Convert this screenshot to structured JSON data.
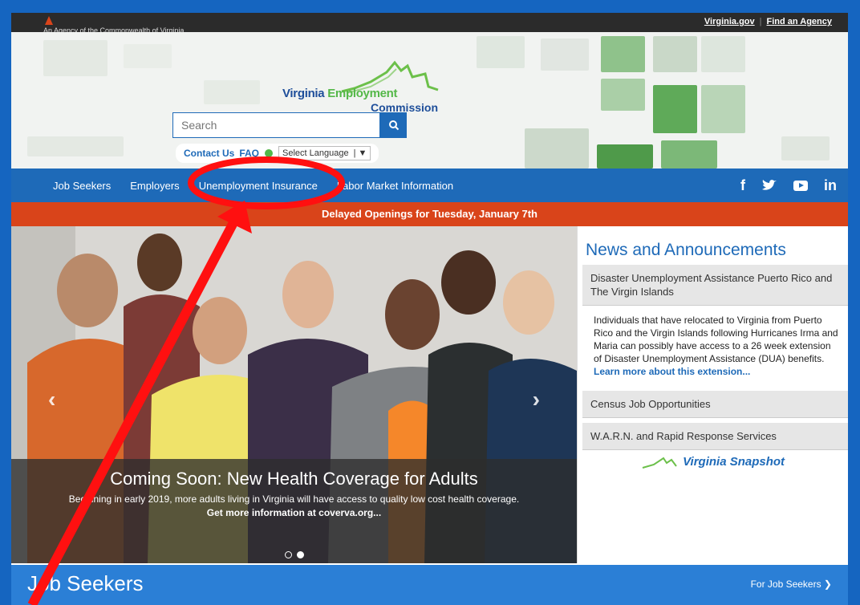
{
  "topbar": {
    "agency_text": "An Agency of the Commonwealth of Virginia",
    "links": [
      "Virginia.gov",
      "Find an Agency"
    ]
  },
  "logo": {
    "line1_a": "Virginia",
    "line1_b": "Employment",
    "line2": "Commission"
  },
  "search": {
    "placeholder": "Search"
  },
  "contacts": {
    "contact_us": "Contact Us",
    "faq": "FAQ",
    "language": "Select Language"
  },
  "nav": {
    "items": [
      "Job Seekers",
      "Employers",
      "Unemployment Insurance",
      "Labor Market Information"
    ]
  },
  "social": {
    "facebook": "f",
    "linkedin": "in"
  },
  "alert": {
    "text": "Delayed Openings for Tuesday, January 7th"
  },
  "carousel": {
    "heading": "Coming Soon: New Health Coverage for Adults",
    "body": "Beginning in early 2019, more adults living in Virginia will have access to quality low cost health coverage.",
    "link": "Get more information at coverva.org...",
    "prev": "‹",
    "next": "›"
  },
  "news": {
    "title": "News and Announcements",
    "items": [
      {
        "heading": "Disaster Unemployment Assistance Puerto Rico and The Virgin Islands",
        "body": "Individuals that have relocated to Virginia from Puerto Rico and the Virgin Islands following Hurricanes Irma and Maria can possibly have access to a 26 week extension of Disaster Unemployment Assistance (DUA) benefits.",
        "link": "Learn more about this extension..."
      },
      {
        "heading": "Census Job Opportunities"
      },
      {
        "heading": "W.A.R.N. and Rapid Response Services"
      }
    ],
    "snapshot": "Virginia Snapshot"
  },
  "bottom": {
    "heading": "Job Seekers",
    "link": "For Job Seekers ❯"
  },
  "colors": {
    "brand_blue": "#1e6ab8",
    "alert_orange": "#d9441a",
    "annotation_red": "#ff1010"
  }
}
